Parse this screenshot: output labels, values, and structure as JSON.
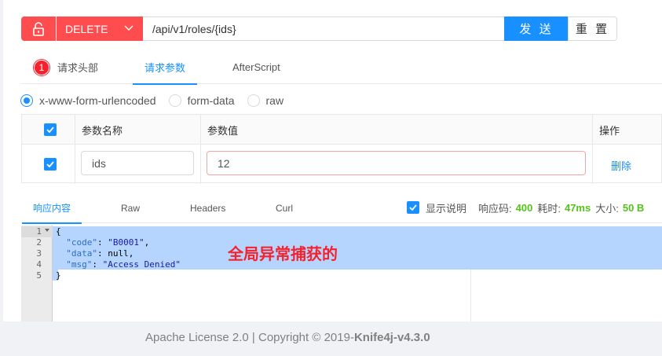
{
  "request": {
    "method": "DELETE",
    "url": "/api/v1/roles/{ids}",
    "send_label": "发 送",
    "reset_label": "重 置"
  },
  "req_tabs": [
    {
      "label": "请求头部",
      "badge": "1",
      "active": false
    },
    {
      "label": "请求参数",
      "active": true
    },
    {
      "label": "AfterScript",
      "active": false
    }
  ],
  "content_types": [
    {
      "label": "x-www-form-urlencoded",
      "selected": true
    },
    {
      "label": "form-data",
      "selected": false
    },
    {
      "label": "raw",
      "selected": false
    }
  ],
  "params": {
    "headers": {
      "name": "参数名称",
      "value": "参数值",
      "action": "操作"
    },
    "rows": [
      {
        "checked": true,
        "name": "ids",
        "value": "12",
        "action": "删除"
      }
    ]
  },
  "resp_tabs": [
    {
      "label": "响应内容",
      "active": true
    },
    {
      "label": "Raw",
      "active": false
    },
    {
      "label": "Headers",
      "active": false
    },
    {
      "label": "Curl",
      "active": false
    }
  ],
  "resp_meta": {
    "show_desc_label": "显示说明",
    "status_label": "响应码:",
    "status": "400",
    "time_label": "耗时:",
    "time": "47ms",
    "size_label": "大小:",
    "size": "50 B"
  },
  "editor": {
    "line_numbers": [
      "1",
      "2",
      "3",
      "4",
      "5"
    ],
    "lines": [
      {
        "open": "{"
      },
      {
        "key": "\"code\"",
        "value": "\"B0001\"",
        "tail": ","
      },
      {
        "key": "\"data\"",
        "value": "null",
        "tail": ","
      },
      {
        "key": "\"msg\"",
        "value": "\"Access Denied\"",
        "tail": ""
      },
      {
        "open": "}"
      }
    ]
  },
  "annotation": "全局异常捕获的",
  "footer": {
    "text": "Apache License 2.0 | Copyright © 2019-",
    "brand": "Knife4j-v4.3.0"
  },
  "colors": {
    "danger": "#ff4d4f",
    "primary": "#1890ff",
    "success": "#52c41a"
  }
}
